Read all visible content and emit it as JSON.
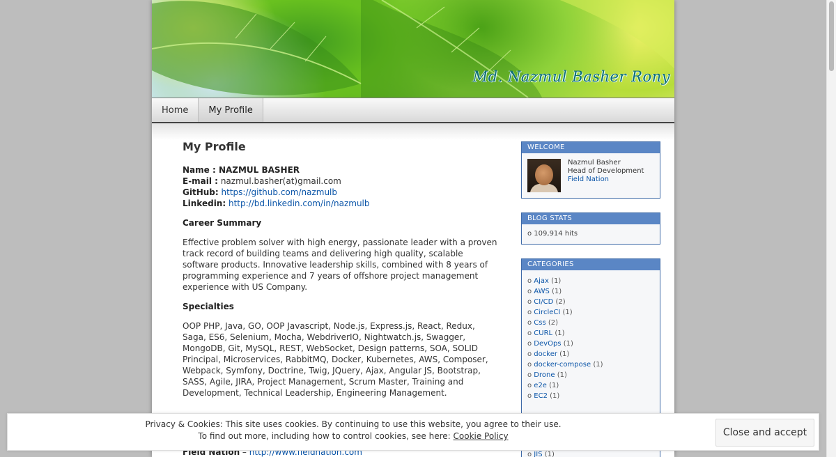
{
  "header": {
    "site_title": "Md. Nazmul Basher Rony"
  },
  "nav": {
    "items": [
      {
        "label": "Home"
      },
      {
        "label": "My Profile"
      }
    ]
  },
  "profile": {
    "title": "My Profile",
    "name_label": "Name : NAZMUL BASHER",
    "email_label": "E-mail :",
    "email_value": "nazmul.basher(at)gmail.com",
    "github_label": "GitHub:",
    "github_url": "https://github.com/nazmulb",
    "linkedin_label": "Linkedin:",
    "linkedin_url": "http://bd.linkedin.com/in/nazmulb",
    "career_heading": "Career Summary",
    "career_text": "Effective problem solver with high energy, passionate leader with a proven track record of building teams and delivering high quality, scalable software products. Innovative leadership skills, combined with 8 years of programming experience and 7 years of offshore project management experience with US Company.",
    "specialties_heading": "Specialties",
    "specialties_text": "OOP PHP, Java, GO, OOP Javascript, Node.js, Express.js, React, Redux, Saga, ES6, Selenium, Mocha, WebdriverIO, Nightwatch.js, Swagger, MongoDB, Git, MySQL, REST, WebSocket, Design patterns, SOA, SOLID Principal, Microservices, RabbitMQ, Docker, Kubernetes, AWS, Composer, Webpack, Symfony, Doctrine, Twig, JQuery, Ajax, Angular JS, Bootstrap, SASS, Agile, JIRA, Project Management, Scrum Master, Training and Development, Technical Leadership, Engineering Management.",
    "job_company": "Field Nation",
    "job_sep": " – ",
    "job_url": "http://www.fieldnation.com"
  },
  "sidebar": {
    "welcome": {
      "title": "WELCOME",
      "name": "Nazmul Basher",
      "role": "Head of Development",
      "company": "Field Nation"
    },
    "blog_stats": {
      "title": "BLOG STATS",
      "hits": "109,914 hits"
    },
    "categories": {
      "title": "CATEGORIES",
      "items": [
        {
          "name": "Ajax",
          "count": "(1)"
        },
        {
          "name": "AWS",
          "count": "(1)"
        },
        {
          "name": "CI/CD",
          "count": "(2)"
        },
        {
          "name": "CircleCI",
          "count": "(1)"
        },
        {
          "name": "Css",
          "count": "(2)"
        },
        {
          "name": "CURL",
          "count": "(1)"
        },
        {
          "name": "DevOps",
          "count": "(1)"
        },
        {
          "name": "docker",
          "count": "(1)"
        },
        {
          "name": "docker-compose",
          "count": "(1)"
        },
        {
          "name": "Drone",
          "count": "(1)"
        },
        {
          "name": "e2e",
          "count": "(1)"
        },
        {
          "name": "EC2",
          "count": "(1)"
        }
      ],
      "partial_item": {
        "name": "JIS",
        "count": "(1)"
      }
    }
  },
  "cookie_banner": {
    "line1": "Privacy & Cookies: This site uses cookies. By continuing to use this website, you agree to their use.",
    "line2_prefix": "To find out more, including how to control cookies, see here:",
    "link_label": "Cookie Policy",
    "button_label": "Close and accept"
  },
  "colors": {
    "widget_header": "#5a86c5",
    "link": "#0b55a8",
    "title_text": "#0d6f72"
  }
}
